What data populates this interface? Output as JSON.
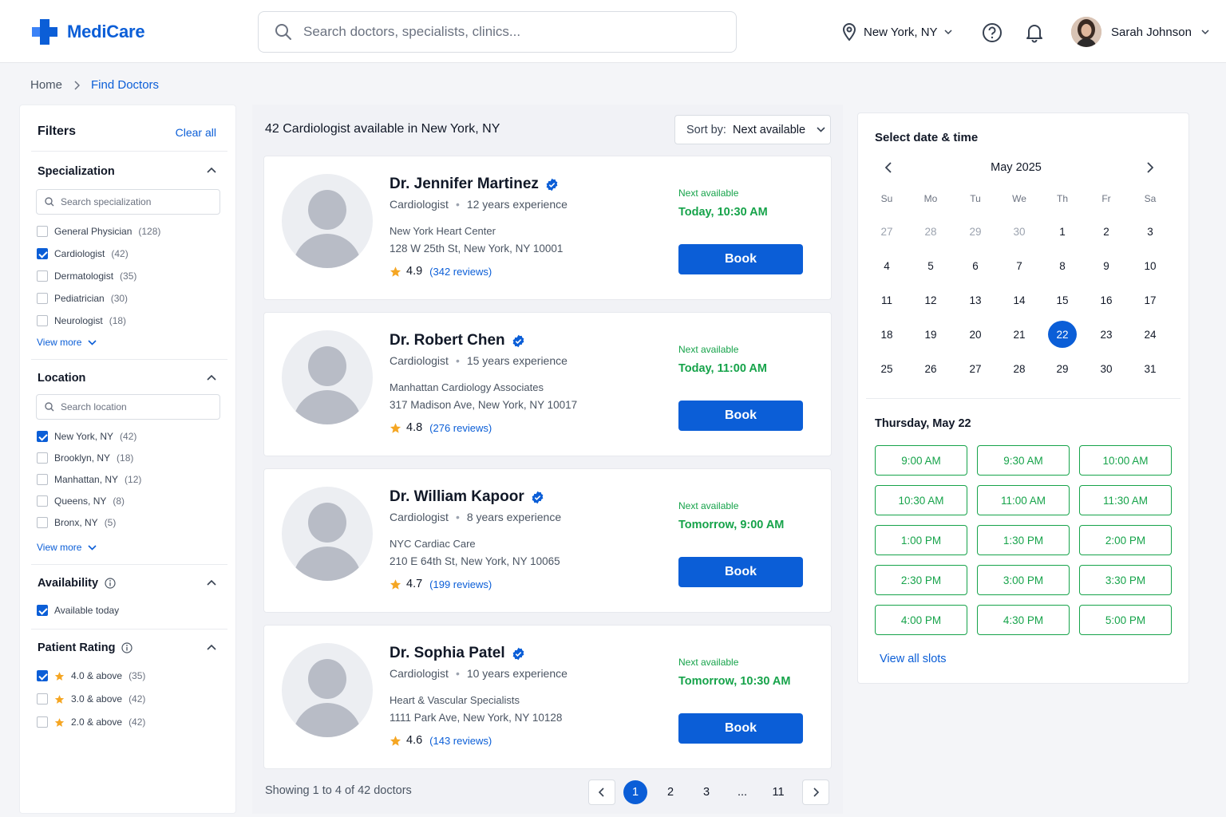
{
  "brand": {
    "name": "MediCare",
    "color": "#0b5ed7"
  },
  "search": {
    "placeholder": "Search doctors, specialists, clinics..."
  },
  "location": {
    "label": "New York, NY"
  },
  "user": {
    "name": "Sarah Johnson"
  },
  "breadcrumb": {
    "home": "Home",
    "current": "Find Doctors"
  },
  "filters": {
    "title": "Filters",
    "clear_all": "Clear all",
    "specialization": {
      "title": "Specialization",
      "search_placeholder": "Search specialization",
      "items": [
        {
          "label": "General Physician",
          "count": "(128)",
          "checked": false
        },
        {
          "label": "Cardiologist",
          "count": "(42)",
          "checked": true
        },
        {
          "label": "Dermatologist",
          "count": "(35)",
          "checked": false
        },
        {
          "label": "Pediatrician",
          "count": "(30)",
          "checked": false
        },
        {
          "label": "Neurologist",
          "count": "(18)",
          "checked": false
        }
      ],
      "view_more": "View more"
    },
    "location": {
      "title": "Location",
      "search_placeholder": "Search location",
      "items": [
        {
          "label": "New York, NY",
          "count": "(42)",
          "checked": true
        },
        {
          "label": "Brooklyn, NY",
          "count": "(18)",
          "checked": false
        },
        {
          "label": "Manhattan, NY",
          "count": "(12)",
          "checked": false
        },
        {
          "label": "Queens, NY",
          "count": "(8)",
          "checked": false
        },
        {
          "label": "Bronx, NY",
          "count": "(5)",
          "checked": false
        }
      ],
      "view_more": "View more"
    },
    "availability": {
      "title": "Availability",
      "items": [
        {
          "label": "Available today",
          "checked": true
        }
      ]
    },
    "rating": {
      "title": "Patient Rating",
      "items": [
        {
          "label": "4.0 & above",
          "count": "(35)",
          "checked": true
        },
        {
          "label": "3.0 & above",
          "count": "(42)",
          "checked": false
        },
        {
          "label": "2.0 & above",
          "count": "(42)",
          "checked": false
        }
      ]
    }
  },
  "results": {
    "title": "42 Cardiologist available in New York, NY",
    "sort_label": "Sort by:",
    "sort_value": "Next available",
    "next_label": "Next available",
    "book_label": "Book",
    "doctors": [
      {
        "name": "Dr. Jennifer Martinez",
        "specialty": "Cardiologist",
        "experience": "12 years experience",
        "clinic": "New York Heart Center",
        "address": "128 W 25th St, New York, NY 10001",
        "rating": "4.9",
        "reviews": "(342 reviews)",
        "next": "Today, 10:30 AM"
      },
      {
        "name": "Dr. Robert Chen",
        "specialty": "Cardiologist",
        "experience": "15 years experience",
        "clinic": "Manhattan Cardiology Associates",
        "address": "317 Madison Ave, New York, NY 10017",
        "rating": "4.8",
        "reviews": "(276 reviews)",
        "next": "Today, 11:00 AM"
      },
      {
        "name": "Dr. William Kapoor",
        "specialty": "Cardiologist",
        "experience": "8 years experience",
        "clinic": "NYC Cardiac Care",
        "address": "210 E 64th St, New York, NY 10065",
        "rating": "4.7",
        "reviews": "(199 reviews)",
        "next": "Tomorrow, 9:00 AM"
      },
      {
        "name": "Dr. Sophia Patel",
        "specialty": "Cardiologist",
        "experience": "10 years experience",
        "clinic": "Heart & Vascular Specialists",
        "address": "1111 Park Ave, New York, NY 10128",
        "rating": "4.6",
        "reviews": "(143 reviews)",
        "next": "Tomorrow, 10:30 AM"
      }
    ],
    "showing": "Showing 1 to 4 of 42 doctors",
    "pagination": [
      "1",
      "2",
      "3",
      "...",
      "11"
    ],
    "current_page": "1"
  },
  "calendar": {
    "title": "Select date & time",
    "month": "May 2025",
    "weekdays": [
      "Su",
      "Mo",
      "Tu",
      "We",
      "Th",
      "Fr",
      "Sa"
    ],
    "weeks": [
      [
        "27",
        "28",
        "29",
        "30",
        "1",
        "2",
        "3"
      ],
      [
        "4",
        "5",
        "6",
        "7",
        "8",
        "9",
        "10"
      ],
      [
        "11",
        "12",
        "13",
        "14",
        "15",
        "16",
        "17"
      ],
      [
        "18",
        "19",
        "20",
        "21",
        "22",
        "23",
        "24"
      ],
      [
        "25",
        "26",
        "27",
        "28",
        "29",
        "30",
        "31"
      ]
    ],
    "selected": "22",
    "selected_date_label": "Thursday, May 22",
    "slots": [
      "9:00 AM",
      "9:30 AM",
      "10:00 AM",
      "10:30 AM",
      "11:00 AM",
      "11:30 AM",
      "1:00 PM",
      "1:30 PM",
      "2:00 PM",
      "2:30 PM",
      "3:00 PM",
      "3:30 PM",
      "4:00 PM",
      "4:30 PM",
      "5:00 PM"
    ],
    "view_all": "View all slots"
  }
}
